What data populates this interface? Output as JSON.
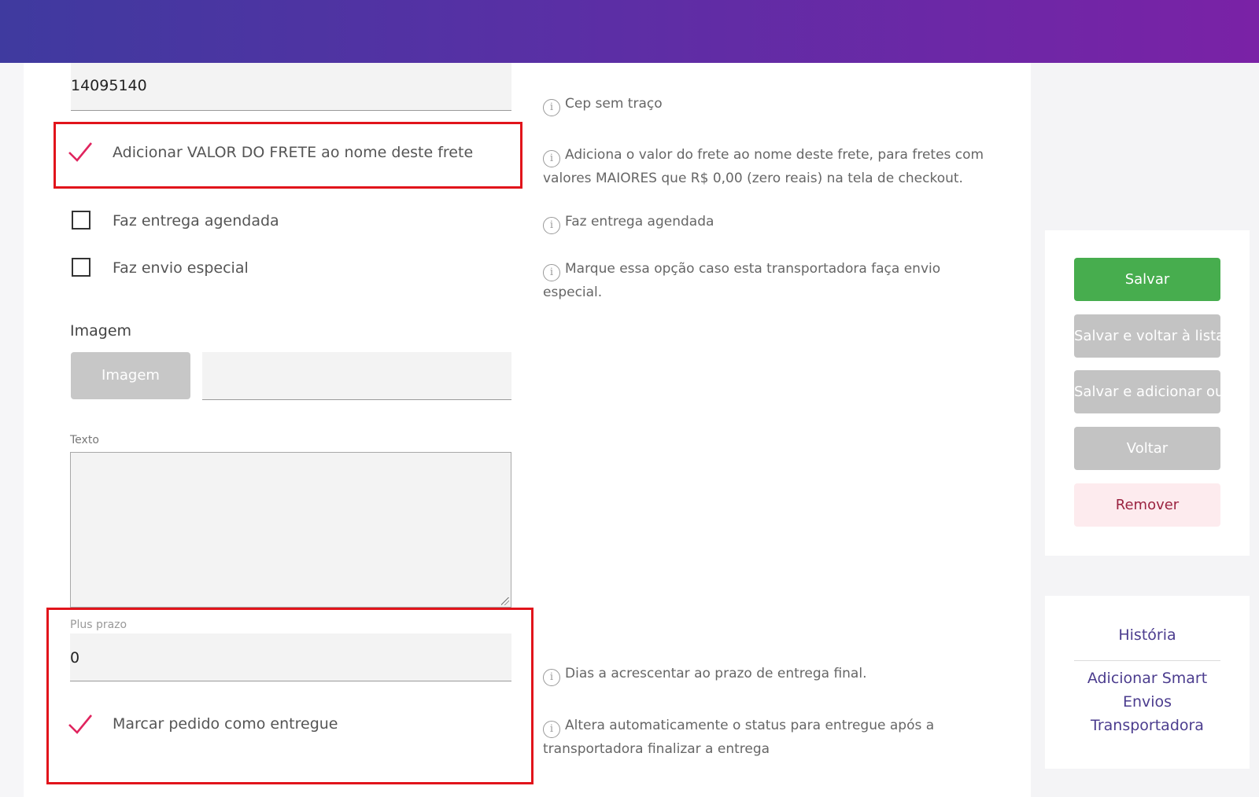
{
  "form": {
    "cep_value": "14095140",
    "cep_hint": "Cep sem traço",
    "add_freight_value_label": "Adicionar VALOR DO FRETE ao nome deste frete",
    "add_freight_value_hint": "Adiciona o valor do frete ao nome deste frete, para fretes com valores MAIORES que R$ 0,00 (zero reais) na tela de checkout.",
    "scheduled_delivery_label": "Faz entrega agendada",
    "scheduled_delivery_hint": "Faz entrega agendada",
    "special_shipping_label": "Faz envio especial",
    "special_shipping_hint": "Marque essa opção caso esta transportadora faça envio especial.",
    "image_section_label": "Imagem",
    "image_button_label": "Imagem",
    "text_label": "Texto",
    "plus_prazo_label": "Plus prazo",
    "plus_prazo_value": "0",
    "plus_prazo_hint": "Dias a acrescentar ao prazo de entrega final.",
    "mark_delivered_label": "Marcar pedido como entregue",
    "mark_delivered_hint": "Altera automaticamente o status para entregue após a transportadora finalizar a entrega"
  },
  "actions": {
    "save": "Salvar",
    "save_back": "Salvar e voltar à lista",
    "save_add": "Salvar e adicionar outro",
    "back": "Voltar",
    "remove": "Remover"
  },
  "side_links": {
    "history": "História",
    "add_smart": "Adicionar Smart Envios Transportadora"
  },
  "colors": {
    "highlight": "#e1141b",
    "checkmark": "#e0245e",
    "save_green": "#47ad4e"
  }
}
